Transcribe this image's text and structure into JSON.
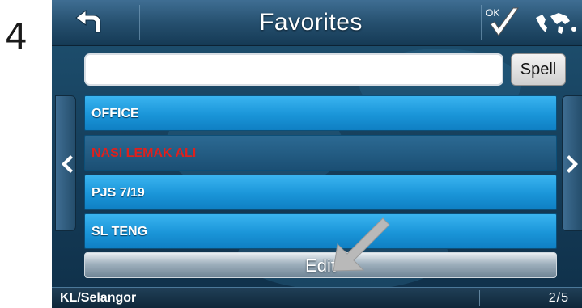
{
  "step_number": "4",
  "header": {
    "title": "Favorites",
    "back_icon": "back-arrow-icon",
    "ok_icon": "ok-check-icon",
    "ok_label": "OK",
    "map_icon": "world-map-icon"
  },
  "search": {
    "value": "",
    "spell_label": "Spell"
  },
  "favorites": [
    {
      "label": "OFFICE"
    },
    {
      "label": "NASI LEMAK ALI"
    },
    {
      "label": "PJS 7/19"
    },
    {
      "label": "SL TENG"
    }
  ],
  "edit_label": "Edit",
  "status": {
    "region": "KL/Selangor",
    "page": "2/5"
  },
  "colors": {
    "list_item": "#1a95d8",
    "selected_text": "#e0201c",
    "background": "#143b57"
  }
}
